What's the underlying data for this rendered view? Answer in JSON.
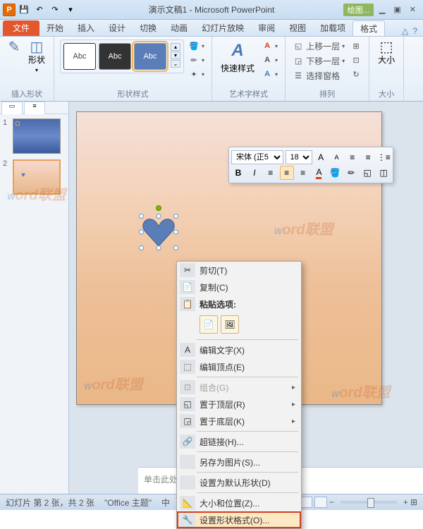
{
  "title": "演示文稿1 - Microsoft PowerPoint",
  "drawtools": "绘图...",
  "tabs": {
    "file": "文件",
    "home": "开始",
    "insert": "插入",
    "design": "设计",
    "transition": "切换",
    "animation": "动画",
    "slideshow": "幻灯片放映",
    "review": "审阅",
    "view": "视图",
    "addins": "加载项",
    "format": "格式"
  },
  "ribbon": {
    "insert_shape": {
      "label": "插入形状",
      "shapes": "形状"
    },
    "shape_style": {
      "label": "形状样式",
      "abc": "Abc",
      "fill": "形状填充",
      "outline": "形状轮廓",
      "effects": "形状效果"
    },
    "wordart": {
      "label": "艺术字样式",
      "quick": "快速样式"
    },
    "arrange": {
      "label": "排列",
      "forward": "上移一层",
      "backward": "下移一层",
      "selection": "选择窗格"
    },
    "size": {
      "label": "大小"
    }
  },
  "thumbs": {
    "n1": "1",
    "n2": "2"
  },
  "mini": {
    "font": "宋体 (正5",
    "size": "18"
  },
  "ctx": {
    "cut": "剪切(T)",
    "copy": "复制(C)",
    "paste_header": "粘贴选项:",
    "edit_text": "编辑文字(X)",
    "edit_points": "编辑顶点(E)",
    "group": "组合(G)",
    "bring_front": "置于顶层(R)",
    "send_back": "置于底层(K)",
    "hyperlink": "超链接(H)...",
    "save_pic": "另存为图片(S)...",
    "set_default": "设置为默认形状(D)",
    "size_pos": "大小和位置(Z)...",
    "format_shape": "设置形状格式(O)..."
  },
  "notes_placeholder": "单击此处添加备注",
  "status": {
    "slide_info": "幻灯片 第 2 张，共 2 张",
    "theme": "\"Office 主题\"",
    "lang": "中"
  },
  "watermark": "Word联盟"
}
